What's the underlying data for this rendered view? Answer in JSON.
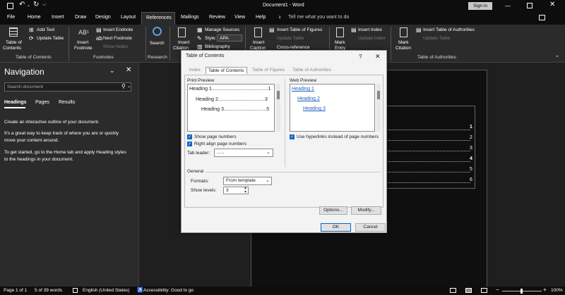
{
  "titlebar": {
    "title": "Document1 - Word",
    "sign_in": "Sign in"
  },
  "tabs": [
    "File",
    "Home",
    "Insert",
    "Draw",
    "Design",
    "Layout",
    "References",
    "Mailings",
    "Review",
    "View",
    "Help"
  ],
  "active_tab": "References",
  "tell_me": "Tell me what you want to do",
  "ribbon": {
    "toc": {
      "label_1": "Table of",
      "label_2": "Contents",
      "add_text": "Add Text",
      "update_table": "Update Table",
      "group": "Table of Contents"
    },
    "footnotes": {
      "insert_footnote_1": "Insert",
      "insert_footnote_2": "Footnote",
      "insert_endnote": "Insert Endnote",
      "next_footnote": "Next Footnote",
      "show_notes": "Show Notes",
      "group": "Footnotes"
    },
    "research": {
      "search": "Search",
      "group": "Research"
    },
    "citations": {
      "insert_citation_1": "Insert",
      "insert_citation_2": "Citation",
      "manage_sources": "Manage Sources",
      "style_label": "Style:",
      "style_value": "APA",
      "bibliography": "Bibliography"
    },
    "captions": {
      "insert_caption_1": "Insert",
      "insert_caption_2": "Caption",
      "insert_tof": "Insert Table of Figures",
      "update_table": "Update Table",
      "cross_reference": "Cross-reference"
    },
    "index": {
      "mark_entry_1": "Mark",
      "mark_entry_2": "Entry",
      "insert_index": "Insert Index",
      "update_index": "Update Index"
    },
    "toa": {
      "mark_citation_1": "Mark",
      "mark_citation_2": "Citation",
      "insert_toa": "Insert Table of Authorities",
      "update_table": "Update Table",
      "group": "Table of Authorities"
    }
  },
  "navigation": {
    "title": "Navigation",
    "search_placeholder": "Search document",
    "tabs": [
      "Headings",
      "Pages",
      "Results"
    ],
    "text_1": "Create an interactive outline of your document.",
    "text_2a": "It's a great way to keep track of where you are or quickly",
    "text_2b": "move your content around.",
    "text_3a": "To get started, go to the Home tab and apply Heading styles",
    "text_3b": "to the headings in your document."
  },
  "document": {
    "toc_numbers": [
      "1",
      "2",
      "3",
      "4",
      "5",
      "6"
    ]
  },
  "dialog": {
    "title": "Table of Contents",
    "help": "?",
    "close": "✕",
    "tabs": [
      "Index",
      "Table of Contents",
      "Table of Figures",
      "Table of Authorities"
    ],
    "active_tab": "Table of Contents",
    "print_preview_label": "Print Preview",
    "print_preview": [
      {
        "text": "Heading 1.........................................1"
      },
      {
        "text": "Heading 2..................................3"
      },
      {
        "text": "Heading 3...............................5"
      }
    ],
    "web_preview_label": "Web Preview",
    "web_preview": [
      "Heading 1",
      "Heading 2",
      "Heading 3"
    ],
    "show_page_numbers": "Show page numbers",
    "right_align": "Right align page numbers",
    "tab_leader_label": "Tab leader:",
    "tab_leader_value": "......",
    "use_hyperlinks": "Use hyperlinks instead of page numbers",
    "general_label": "General",
    "formats_label": "Formats:",
    "formats_value": "From template",
    "show_levels_label": "Show levels:",
    "show_levels_value": "3",
    "options_button": "Options...",
    "modify_button": "Modify...",
    "ok_button": "OK",
    "cancel_button": "Cancel"
  },
  "statusbar": {
    "page": "Page 1 of 1",
    "words": "5 of 39 words",
    "language": "English (United States)",
    "accessibility": "Accessibility: Good to go",
    "zoom": "100%"
  }
}
